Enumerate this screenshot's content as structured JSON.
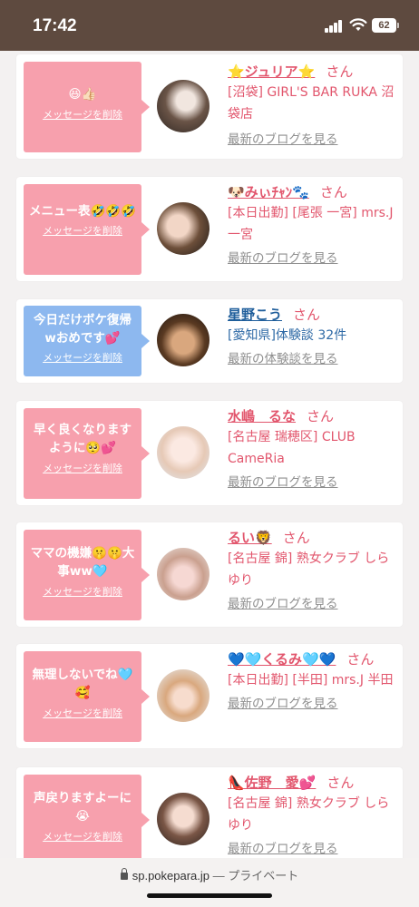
{
  "status_bar": {
    "time": "17:42",
    "battery": "62"
  },
  "colors": {
    "pink": "#f7a0ad",
    "blue": "#8db8ef",
    "name_pink": "#e2566d",
    "name_blue": "#1f5e9b",
    "header": "#5e4a3f"
  },
  "delete_label": "メッセージを削除",
  "honorific": "さん",
  "cards": [
    {
      "message": "😆👍🏻",
      "bubble_color": "pink",
      "name": "⭐ジュリア⭐",
      "shop": "[沼袋] GIRL'S BAR RUKA 沼袋店",
      "link": "最新のブログを見る",
      "avatar": "avatar-photo"
    },
    {
      "message": "メニュー表🤣🤣🤣",
      "bubble_color": "pink",
      "name": "🐶みぃﾁｬﾝ🐾",
      "shop": "[本日出勤] [尾張 一宮] mrs.J 一宮",
      "link": "最新のブログを見る",
      "avatar": "avatar-photo"
    },
    {
      "message": "今日だけボケ復帰wおめです💕",
      "bubble_color": "blue",
      "name": "星野こう",
      "shop": "[愛知県]体験談 32件",
      "link": "最新の体験談を見る",
      "avatar": "avatar-photo"
    },
    {
      "message": "早く良くなりますように🥺💕",
      "bubble_color": "pink",
      "name": "水嶋　るな",
      "shop": "[名古屋 瑞穂区] CLUB CameRia",
      "link": "最新のブログを見る",
      "avatar": "avatar-photo"
    },
    {
      "message": "ママの機嫌🤫🤫大事ww🩵",
      "bubble_color": "pink",
      "name": "るい🦁",
      "shop": "[名古屋 錦] 熟女クラブ しらゆり",
      "link": "最新のブログを見る",
      "avatar": "avatar-photo"
    },
    {
      "message": "無理しないでね🩵🥰",
      "bubble_color": "pink",
      "name": "💙🩵くるみ🩵💙",
      "shop": "[本日出勤] [半田] mrs.J 半田",
      "link": "最新のブログを見る",
      "avatar": "avatar-photo"
    },
    {
      "message": "声戻りますよーに😭",
      "bubble_color": "pink",
      "name": "👠佐野　愛💕",
      "shop": "[名古屋 錦] 熟女クラブ しらゆり",
      "link": "最新のブログを見る",
      "avatar": "avatar-photo"
    }
  ],
  "url_bar": {
    "domain": "sp.pokepara.jp",
    "suffix": " — プライベート"
  }
}
